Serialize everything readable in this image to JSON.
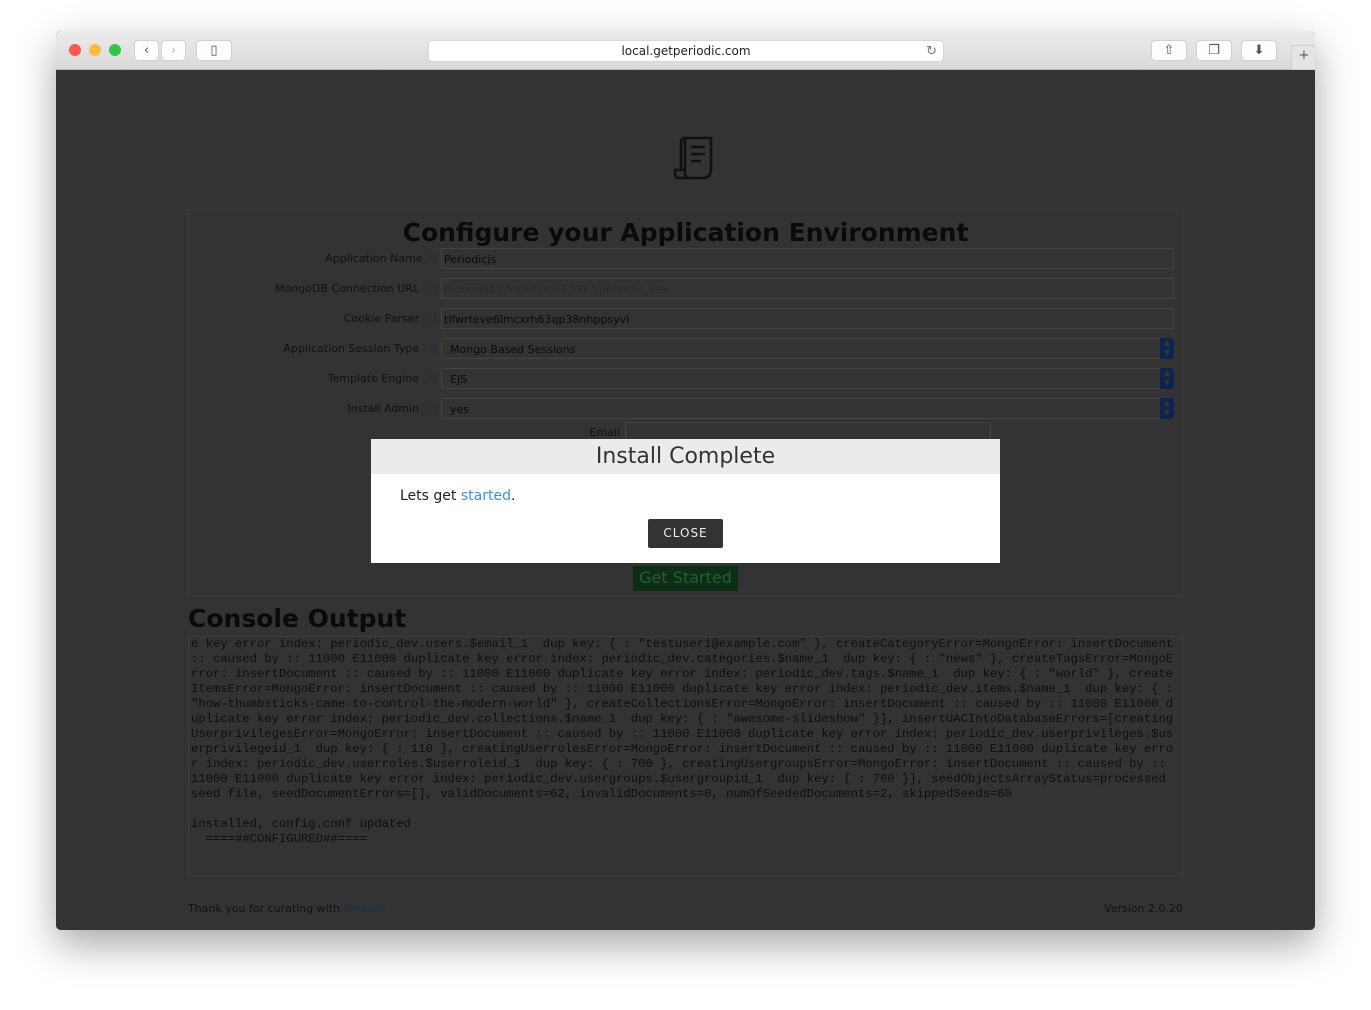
{
  "browser": {
    "url": "local.getperiodic.com",
    "colors": {
      "close": "#fc5753",
      "minimize": "#fdbc40",
      "zoom": "#33c748"
    }
  },
  "form": {
    "title": "Configure your Application Environment",
    "help": "[?]",
    "fields": [
      {
        "label": "Application Name",
        "value": "Periodicjs",
        "type": "text"
      },
      {
        "label": "MongoDB Connection URL ",
        "value": "mongodb://localhost:27017/periodic_dev",
        "type": "placeholder"
      },
      {
        "label": "Cookie Parser ",
        "value": "tlfwrteve6lmcxrh63qp38nhppsyvi",
        "type": "text"
      },
      {
        "label": "Application Session Type ",
        "value": "Mongo Based Sessions",
        "type": "select"
      },
      {
        "label": "Template Engine ",
        "value": "EJS",
        "type": "select"
      },
      {
        "label": "Install Admin ",
        "value": "yes",
        "type": "select"
      }
    ],
    "email_label": "Email",
    "submit_label": "Get Started"
  },
  "console": {
    "title": "Console Output",
    "text": "e key error index: periodic_dev.users.$email_1  dup key: { : \"testuser1@example.com\" }, createCategoryError=MongoError: insertDocument :: caused by :: 11000 E11000 duplicate key error index: periodic_dev.categories.$name_1  dup key: { : \"news\" }, createTagsError=MongoError: insertDocument :: caused by :: 11000 E11000 duplicate key error index: periodic_dev.tags.$name_1  dup key: { : \"world\" }, createItemsError=MongoError: insertDocument :: caused by :: 11000 E11000 duplicate key error index: periodic_dev.items.$name_1  dup key: { : \"how-thumbsticks-came-to-control-the-modern-world\" }, createCollectionsError=MongoError: insertDocument :: caused by :: 11000 E11000 duplicate key error index: periodic_dev.collections.$name_1  dup key: { : \"awesome-slideshow\" }], insertUACIntoDatabaseErrors=[creatingUserprivilegesError=MongoError: insertDocument :: caused by :: 11000 E11000 duplicate key error index: periodic_dev.userprivileges.$userprivilegeid_1  dup key: { : 110 }, creatingUserrolesError=MongoError: insertDocument :: caused by :: 11000 E11000 duplicate key error index: periodic_dev.userroles.$userroleid_1  dup key: { : 700 }, creatingUsergroupsError=MongoError: insertDocument :: caused by :: 11000 E11000 duplicate key error index: periodic_dev.usergroups.$usergroupid_1  dup key: { : 700 }], seedObjectsArrayStatus=processed seed file, seedDocumentErrors=[], validDocuments=62, invalidDocuments=0, numOfSeededDocuments=2, skippedSeeds=60\n\ninstalled, config.conf updated\n  ====##CONFIGURED##===="
  },
  "footer": {
    "thanks": "Thank you for curating with ",
    "link": "Periodic",
    "version": "Version 2.0.20"
  },
  "modal": {
    "title": "Install Complete",
    "text_before": "Lets get ",
    "link": "started",
    "text_after": ".",
    "close_label": "CLOSE"
  }
}
